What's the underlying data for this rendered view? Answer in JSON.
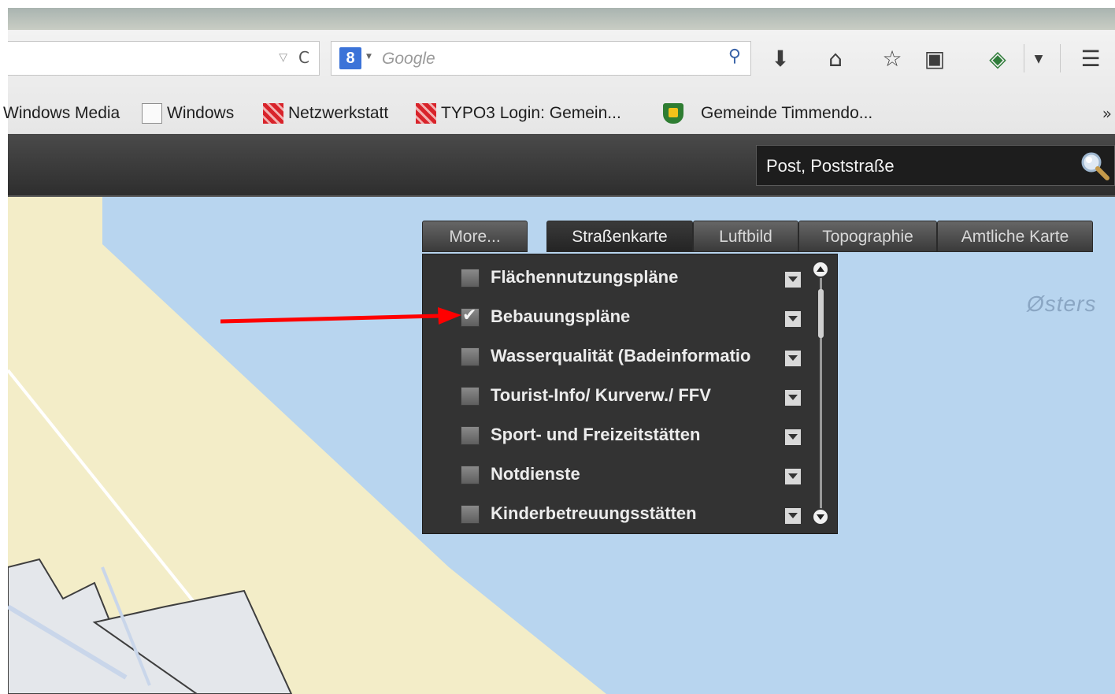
{
  "browser": {
    "search_placeholder": "Google",
    "bookmarks": [
      {
        "label": "Windows Media",
        "icon": "none"
      },
      {
        "label": "Windows",
        "icon": "blank-page-icon"
      },
      {
        "label": "Netzwerkstatt",
        "icon": "red-grid-icon"
      },
      {
        "label": "TYPO3 Login: Gemein...",
        "icon": "red-grid-icon"
      },
      {
        "label": "Gemeinde Timmendo...",
        "icon": "shield-icon"
      }
    ],
    "more_bookmarks": "»"
  },
  "app": {
    "search_value": "Post, Poststraße"
  },
  "tabs": [
    {
      "label": "More...",
      "active": false
    },
    {
      "label": "Straßenkarte",
      "active": true
    },
    {
      "label": "Luftbild",
      "active": false
    },
    {
      "label": "Topographie",
      "active": false
    },
    {
      "label": "Amtliche Karte",
      "active": false
    }
  ],
  "layers": [
    {
      "label": "Flächennutzungspläne",
      "checked": false
    },
    {
      "label": "Bebauungspläne",
      "checked": true
    },
    {
      "label": "Wasserqualität (Badeinformatio",
      "checked": false
    },
    {
      "label": "Tourist-Info/ Kurverw./ FFV",
      "checked": false
    },
    {
      "label": "Sport- und Freizeitstätten",
      "checked": false
    },
    {
      "label": "Notdienste",
      "checked": false
    },
    {
      "label": "Kinderbetreuungsstätten",
      "checked": false
    }
  ],
  "map": {
    "sea_label": "Østers",
    "sea_color": "#b8d5ef",
    "land_color": "#f3edc8",
    "arrow_color": "#ff0000"
  }
}
